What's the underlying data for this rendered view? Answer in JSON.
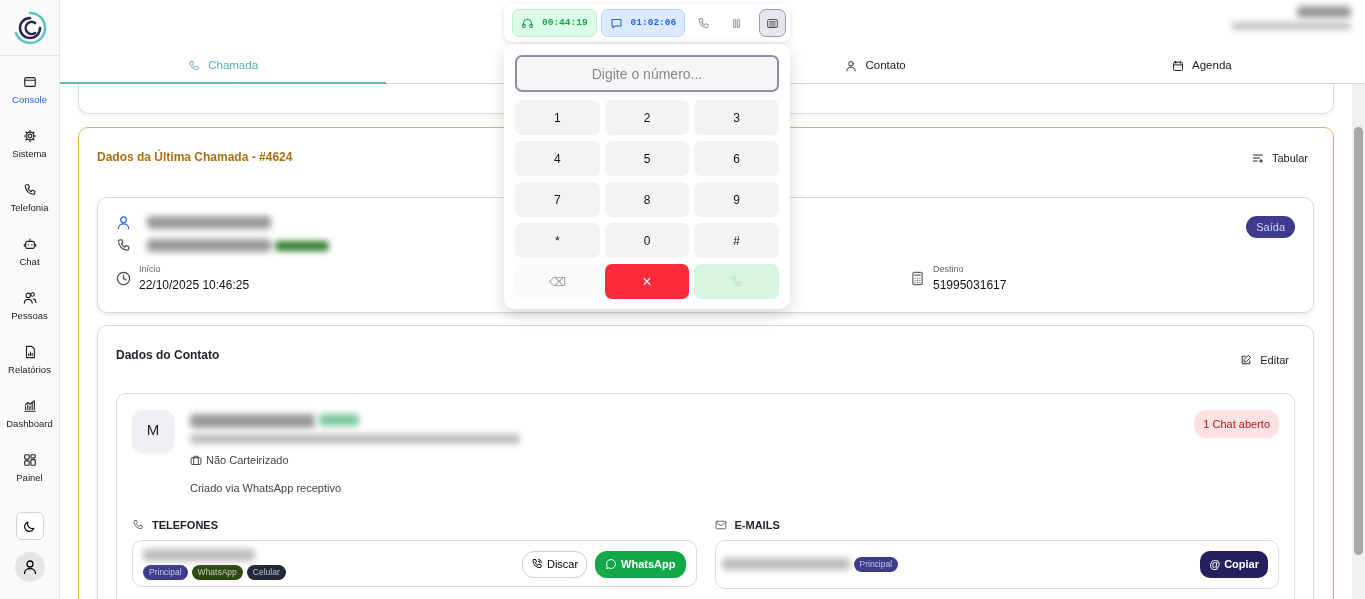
{
  "sidebar": {
    "items": [
      {
        "label": "Console",
        "selected": true
      },
      {
        "label": "Sistema",
        "selected": false
      },
      {
        "label": "Telefonia",
        "selected": false
      },
      {
        "label": "Chat",
        "selected": false
      },
      {
        "label": "Pessoas",
        "selected": false
      },
      {
        "label": "Relatórios",
        "selected": false
      },
      {
        "label": "Dashboard",
        "selected": false
      },
      {
        "label": "Painel",
        "selected": false
      }
    ]
  },
  "call_toolbar": {
    "timers": [
      {
        "kind": "call",
        "text": "00:44:19"
      },
      {
        "kind": "chat",
        "text": "01:02:06"
      }
    ],
    "dialpad_open": true
  },
  "tabs": [
    {
      "label": "Chamada",
      "selected": true
    },
    {
      "label": "Contato",
      "selected": false
    },
    {
      "label": "Agenda",
      "selected": false
    }
  ],
  "dialpad": {
    "placeholder": "Digite o número...",
    "keys": [
      "1",
      "2",
      "3",
      "4",
      "5",
      "6",
      "7",
      "8",
      "9",
      "*",
      "0",
      "#"
    ],
    "actions": [
      {
        "kind": "backspace",
        "text": "⌫"
      },
      {
        "kind": "hangup",
        "text": "×"
      },
      {
        "kind": "call"
      }
    ]
  },
  "last_call": {
    "title": "Dados da Última Chamada - #4624",
    "action": "Tabular",
    "start_label": "Início",
    "start_value": "22/10/2025 10:46:25",
    "destination_label": "Destino",
    "destination_value": "51995031617",
    "direction": "Saída"
  },
  "contact": {
    "title": "Dados do Contato",
    "action": "Editar",
    "avatar": "M",
    "portfolio": "Não Carteirizado",
    "origin": "Criado via WhatsApp receptivo",
    "chat_badge": "1 Chat aberto",
    "phones": {
      "heading": "TELEFONES",
      "items": [
        {
          "tags": [
            {
              "text": "Principal",
              "color": "#3d3b8e"
            },
            {
              "text": "WhatsApp",
              "color": "#2d4a12"
            },
            {
              "text": "Celular",
              "color": "#1f2937"
            }
          ],
          "dial": "Discar",
          "whatsapp": "WhatsApp"
        }
      ]
    },
    "emails": {
      "heading": "E-MAILS",
      "items": [
        {
          "tags": [
            {
              "text": "Principal",
              "color": "#3d3b8e"
            }
          ],
          "copy_glyph": "@",
          "copy": "Copiar"
        }
      ]
    }
  }
}
